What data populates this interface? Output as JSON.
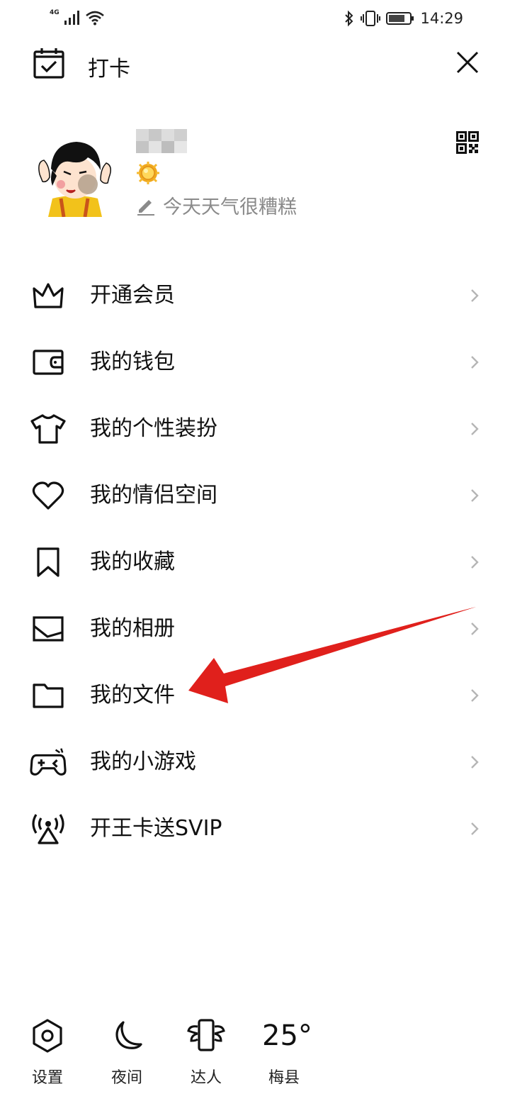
{
  "status_bar": {
    "network": "4G",
    "time": "14:29",
    "icons": [
      "signal-icon",
      "wifi-icon",
      "bluetooth-icon",
      "vibrate-icon",
      "battery-icon"
    ]
  },
  "top_bar": {
    "checkin_label": "打卡",
    "checkin_icon": "calendar-check-icon",
    "close_icon": "close-icon"
  },
  "profile": {
    "signature": "今天天气很糟糕",
    "level_icon": "sun-badge-icon",
    "qr_icon": "qr-code-icon",
    "edit_icon": "pencil-icon"
  },
  "menu": {
    "items": [
      {
        "label": "开通会员",
        "icon": "crown-icon"
      },
      {
        "label": "我的钱包",
        "icon": "wallet-icon"
      },
      {
        "label": "我的个性装扮",
        "icon": "tshirt-icon"
      },
      {
        "label": "我的情侣空间",
        "icon": "heart-icon"
      },
      {
        "label": "我的收藏",
        "icon": "bookmark-icon"
      },
      {
        "label": "我的相册",
        "icon": "photo-icon"
      },
      {
        "label": "我的文件",
        "icon": "folder-icon"
      },
      {
        "label": "我的小游戏",
        "icon": "gamepad-icon"
      },
      {
        "label": "开王卡送SVIP",
        "icon": "broadcast-icon"
      }
    ]
  },
  "annotation": {
    "color": "#e0201c",
    "icon": "red-arrow-annotation"
  },
  "bottom_bar": {
    "settings_label": "设置",
    "night_label": "夜间",
    "talent_label": "达人",
    "weather_temp": "25°",
    "weather_city": "梅县"
  }
}
